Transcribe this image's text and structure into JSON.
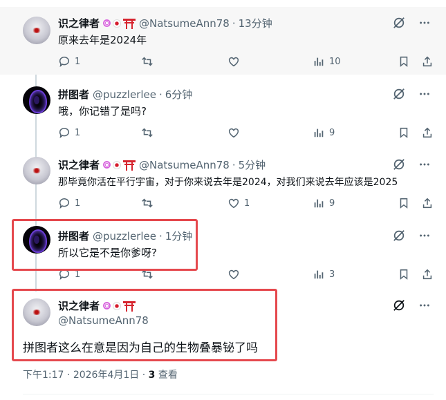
{
  "replies": [
    {
      "name": "识之律者",
      "handle": "@NatsumeAnn78",
      "time": "13分钟",
      "text": "原来去年是2024年",
      "reply_count": "1",
      "like_count": "",
      "view_count": "10",
      "avatar": "wolf-girl-avatar"
    },
    {
      "name": "拼图者",
      "handle": "@puzzlerlee",
      "time": "6分钟",
      "text": "哦，你记错了是吗?",
      "reply_count": "1",
      "like_count": "",
      "view_count": "9",
      "avatar": "puzzle-avatar"
    },
    {
      "name": "识之律者",
      "handle": "@NatsumeAnn78",
      "time": "5分钟",
      "text": "那毕竟你活在平行宇宙，对于你来说去年是2024，对我们来说去年应该是2025",
      "reply_count": "1",
      "like_count": "1",
      "view_count": "9",
      "avatar": "wolf-girl-avatar"
    },
    {
      "name": "拼图者",
      "handle": "@puzzlerlee",
      "time": "1分钟",
      "text": "所以它是不是你爹呀?",
      "reply_count": "1",
      "like_count": "",
      "view_count": "3",
      "avatar": "puzzle-avatar"
    }
  ],
  "main_post": {
    "name": "识之律者",
    "handle": "@NatsumeAnn78",
    "text": "拼图者这么在意是因为自己的生物叠暴铋了吗",
    "time": "下午1:17",
    "date": "2026年4月1日",
    "views_count": "3",
    "views_label": "查看",
    "dot": "·"
  },
  "separator": "·",
  "colors": {
    "highlight_box": "#e5484d",
    "muted": "#536471",
    "thread_line": "#cfd9de"
  }
}
